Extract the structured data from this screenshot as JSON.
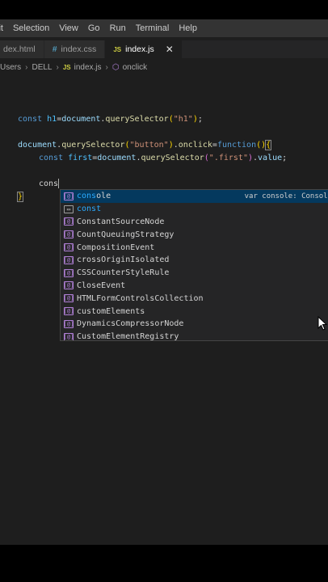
{
  "menu": [
    "lit",
    "Selection",
    "View",
    "Go",
    "Run",
    "Terminal",
    "Help"
  ],
  "tabs": [
    {
      "label": "dex.html",
      "icon": "html-file-icon"
    },
    {
      "label": "index.css",
      "icon": "css-file-icon"
    },
    {
      "label": "index.js",
      "icon": "js-file-icon",
      "active": true
    }
  ],
  "tab_icons": {
    "css": "#",
    "js": "JS"
  },
  "breadcrumb": [
    "Users",
    "DELL",
    "index.js",
    "onclick"
  ],
  "code": {
    "line1": {
      "kw": "const",
      "name": "h1",
      "obj": "document",
      "fn": "querySelector",
      "arg": "\"h1\""
    },
    "line2": {
      "obj": "document",
      "fn": "querySelector",
      "arg": "\"button\"",
      "prop": "onclick",
      "kw": "function"
    },
    "line3": {
      "kw": "const",
      "name": "first",
      "obj": "document",
      "fn": "querySelector",
      "arg": "\".first\"",
      "prop": "value"
    },
    "line4": "cons",
    "line5": "}"
  },
  "suggestions": [
    {
      "match": "cons",
      "rest": "ole",
      "icon": "variable",
      "detail": "var console: Console"
    },
    {
      "match": "const",
      "rest": "",
      "icon": "keyword"
    },
    {
      "label": "ConstantSourceNode",
      "icon": "variable"
    },
    {
      "label": "CountQueuingStrategy",
      "icon": "variable"
    },
    {
      "label": "CompositionEvent",
      "icon": "variable"
    },
    {
      "label": "crossOriginIsolated",
      "icon": "variable"
    },
    {
      "label": "CSSCounterStyleRule",
      "icon": "variable"
    },
    {
      "label": "CloseEvent",
      "icon": "variable"
    },
    {
      "label": "HTMLFormControlsCollection",
      "icon": "variable"
    },
    {
      "label": "customElements",
      "icon": "variable"
    },
    {
      "label": "DynamicsCompressorNode",
      "icon": "variable"
    },
    {
      "label": "CustomElementRegistry",
      "icon": "variable"
    }
  ],
  "icon_glyph": "[@]",
  "colors": {
    "status_bar": "#68217a",
    "selection": "#04395e",
    "match": "#2aaaff"
  }
}
